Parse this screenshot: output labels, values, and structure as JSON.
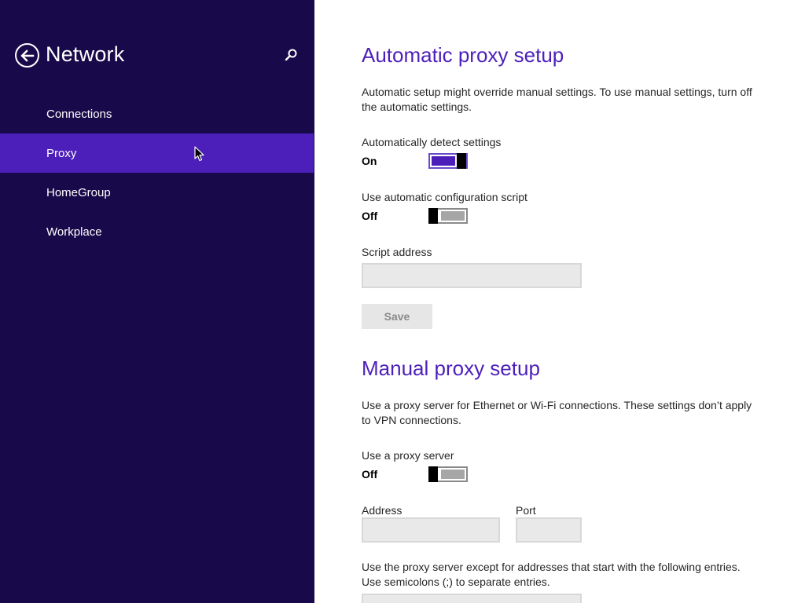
{
  "sidebar": {
    "title": "Network",
    "back_icon": "back-arrow-icon",
    "search_icon": "search-icon",
    "items": [
      {
        "label": "Connections",
        "selected": false
      },
      {
        "label": "Proxy",
        "selected": true
      },
      {
        "label": "HomeGroup",
        "selected": false
      },
      {
        "label": "Workplace",
        "selected": false
      }
    ]
  },
  "automatic": {
    "heading": "Automatic proxy setup",
    "description": "Automatic setup might override manual settings. To use manual settings, turn off the automatic settings.",
    "detect": {
      "label": "Automatically detect settings",
      "state": "On",
      "on": true
    },
    "script": {
      "label": "Use automatic configuration script",
      "state": "Off",
      "on": false
    },
    "script_address": {
      "label": "Script address",
      "value": ""
    },
    "save_label": "Save"
  },
  "manual": {
    "heading": "Manual proxy setup",
    "description": "Use a proxy server for Ethernet or Wi-Fi connections. These settings don’t apply to VPN connections.",
    "use_proxy": {
      "label": "Use a proxy server",
      "state": "Off",
      "on": false
    },
    "address": {
      "label": "Address",
      "value": ""
    },
    "port": {
      "label": "Port",
      "value": ""
    },
    "exceptions_description": "Use the proxy server except for addresses that start with the following entries. Use semicolons (;) to separate entries."
  },
  "colors": {
    "sidebar_bg": "#180a4a",
    "selected_bg": "#4d1fba",
    "accent": "#4d1fba"
  }
}
